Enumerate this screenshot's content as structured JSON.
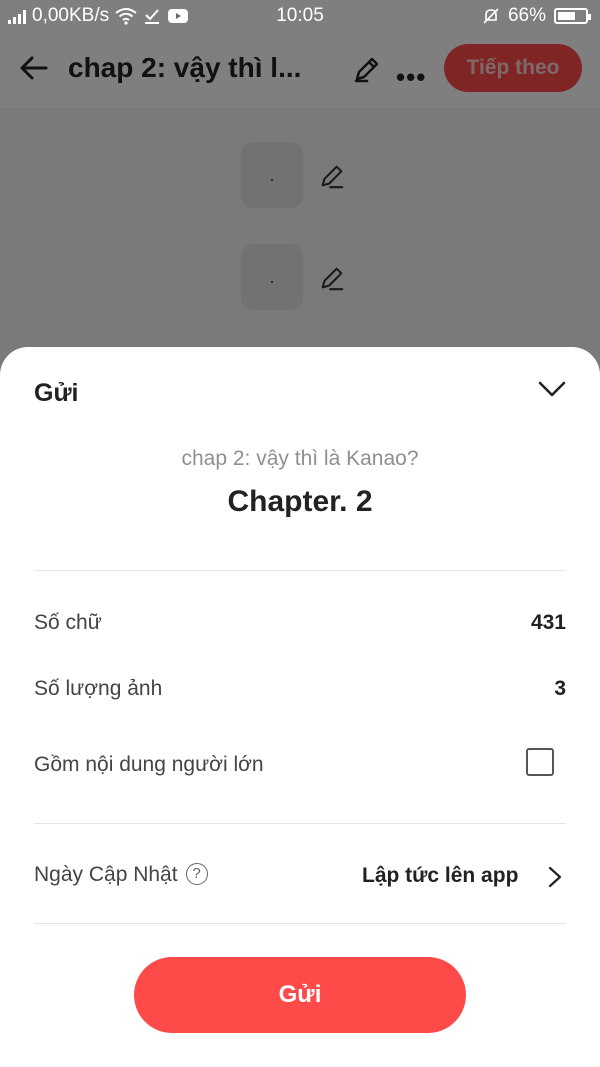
{
  "status_bar": {
    "network_speed": "0,00KB/s",
    "time": "10:05",
    "battery_percent": "66%",
    "battery_level": 0.66
  },
  "header": {
    "title": "chap 2: vậy thì l...",
    "next_button": "Tiếp theo"
  },
  "content": {
    "blocks": [
      {
        "placeholder": "."
      },
      {
        "placeholder": "."
      }
    ]
  },
  "sheet": {
    "title": "Gửi",
    "chapter_subtitle": "chap 2: vậy thì là Kanao?",
    "chapter_name": "Chapter. 2",
    "word_count_label": "Số chữ",
    "word_count_value": "431",
    "image_count_label": "Số lượng ảnh",
    "image_count_value": "3",
    "adult_content_label": "Gồm nội dung người lớn",
    "adult_content_checked": false,
    "update_date_label": "Ngày Cập Nhật",
    "help_icon_glyph": "?",
    "update_date_value": "Lập tức lên app",
    "submit_button": "Gửi"
  },
  "colors": {
    "accent": "#ff4a4a",
    "text_primary": "#222222",
    "text_secondary": "#8f8f8f"
  },
  "icons": [
    "back-arrow-icon",
    "pencil-icon",
    "more-dots-icon",
    "chevron-down-icon",
    "chevron-right-icon",
    "help-icon",
    "wifi-icon",
    "signal-icon",
    "download-icon",
    "youtube-icon",
    "mute-bell-icon",
    "battery-icon"
  ]
}
